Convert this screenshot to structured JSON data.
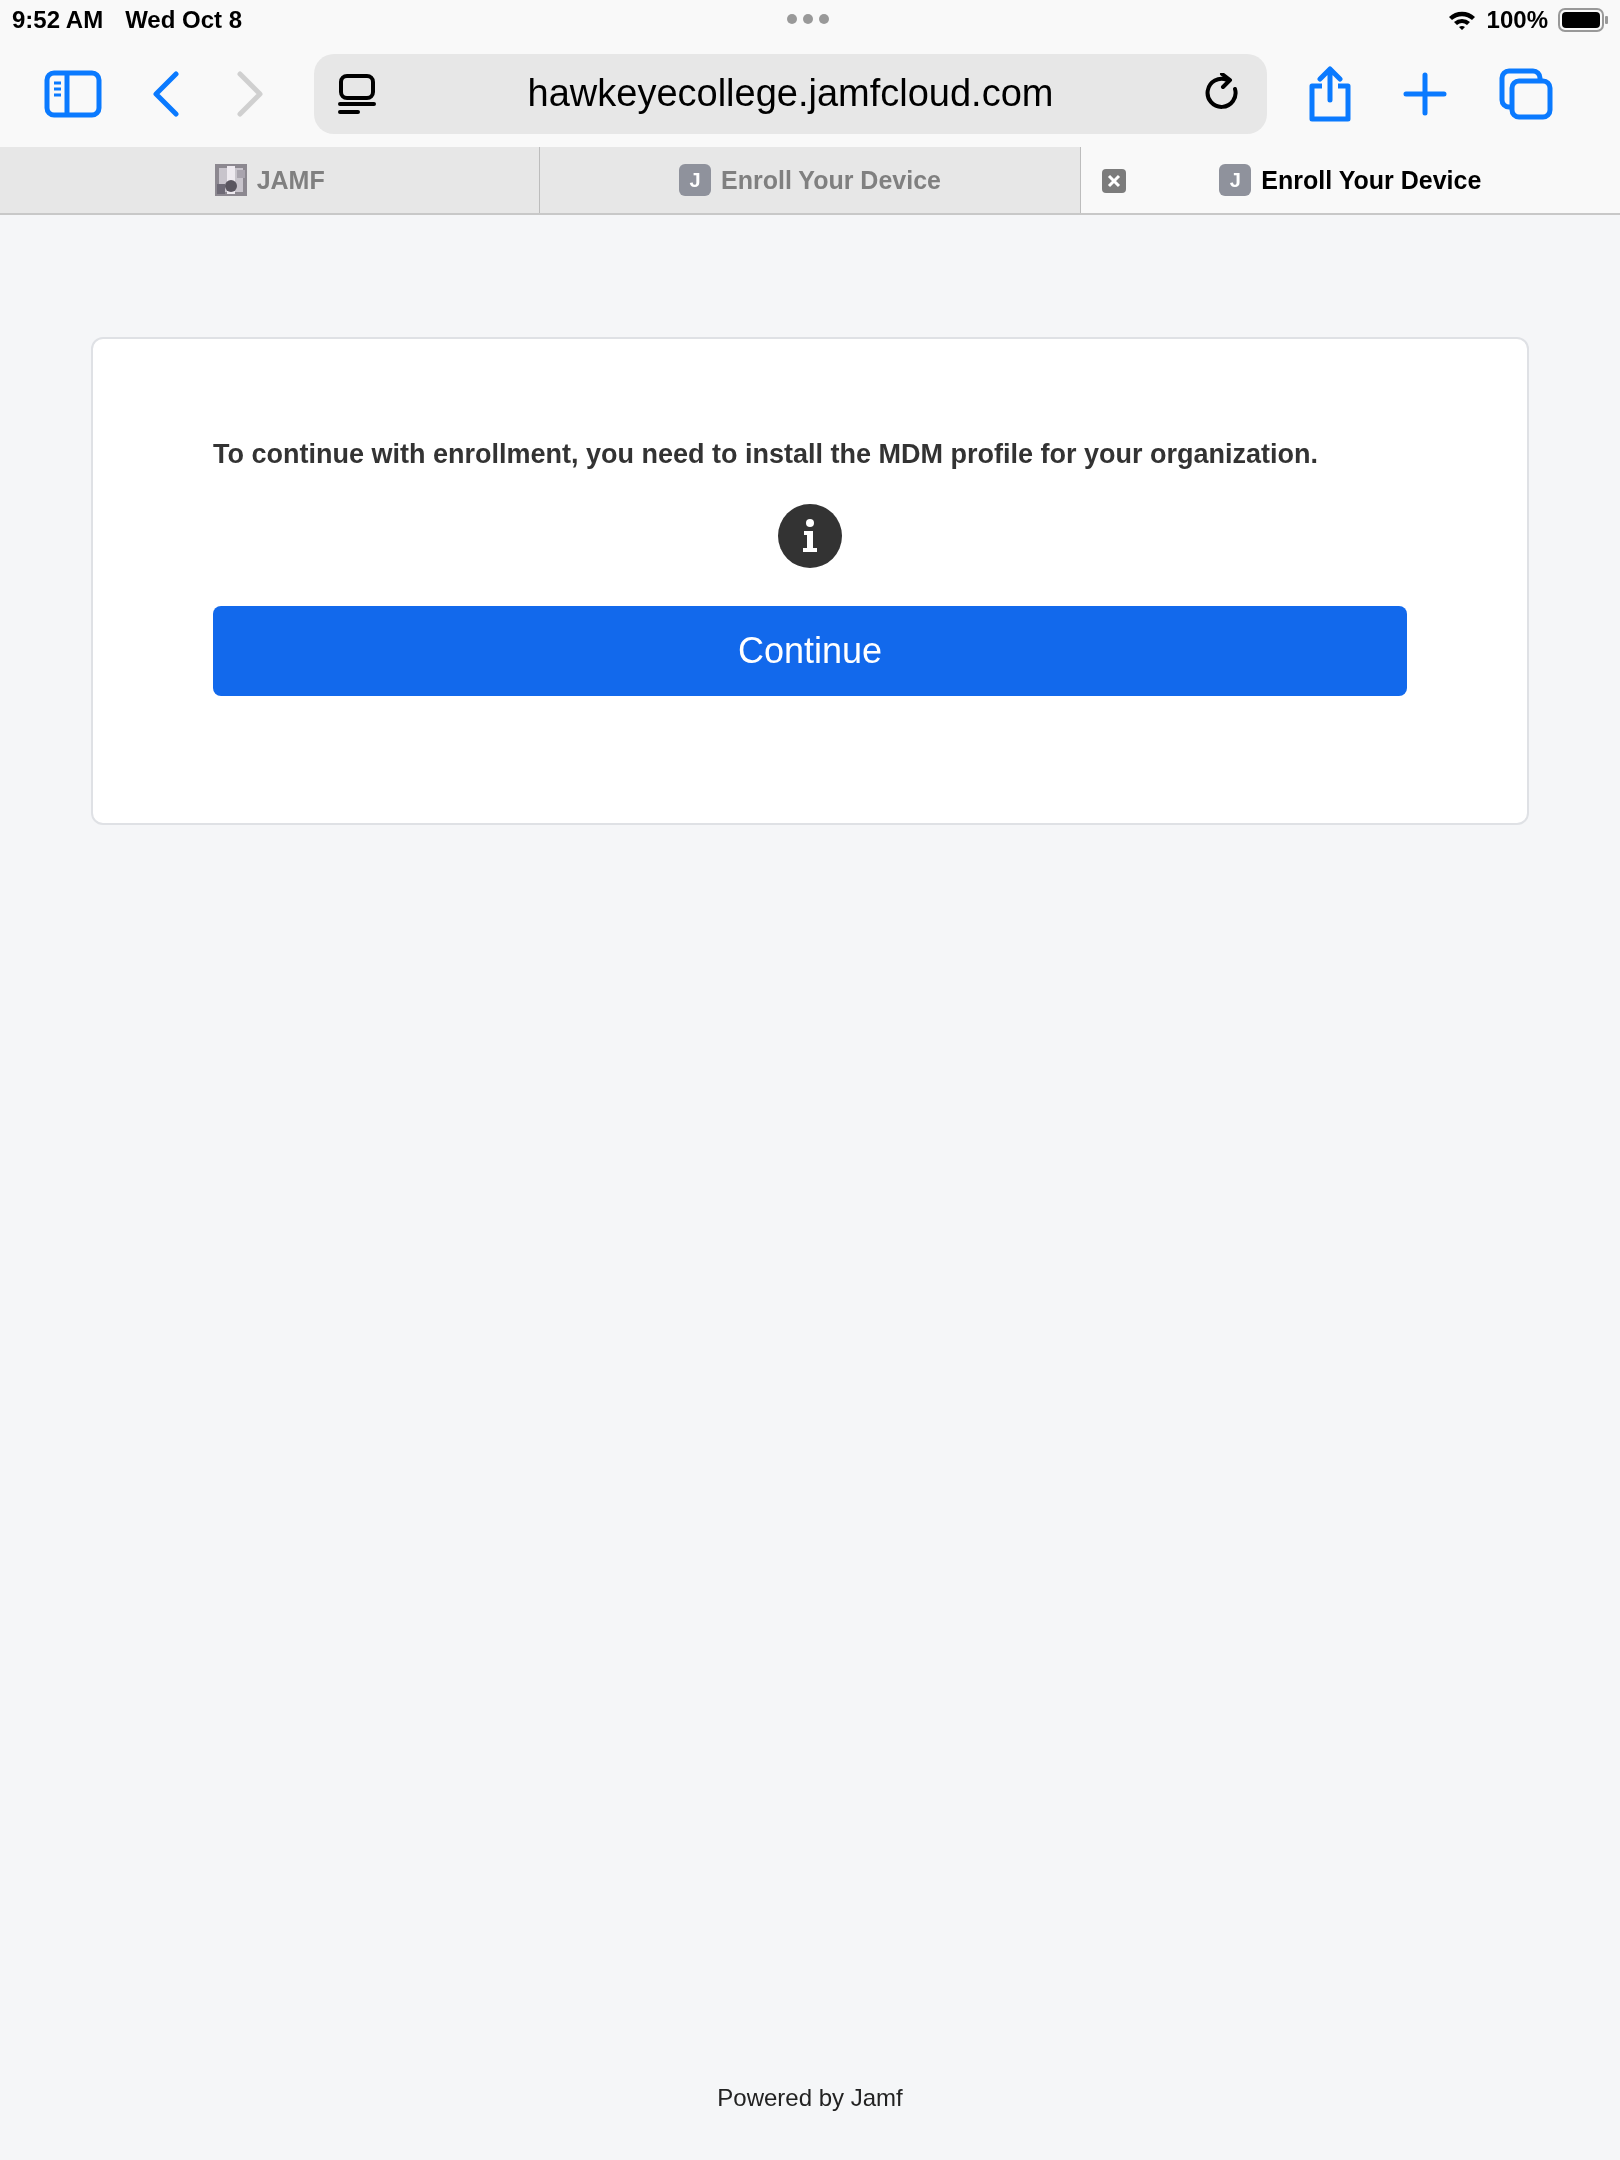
{
  "status_bar": {
    "time": "9:52 AM",
    "date": "Wed Oct 8",
    "battery": "100%"
  },
  "toolbar": {
    "url": "hawkeyecollege.jamfcloud.com"
  },
  "tabs": [
    {
      "title": "JAMF",
      "selected": false
    },
    {
      "title": "Enroll Your Device",
      "favicon": {
        "kind": "letter",
        "letter": "J"
      },
      "selected": false
    },
    {
      "title": "Enroll Your Device",
      "favicon": {
        "kind": "letter",
        "letter": "J"
      },
      "selected": true
    }
  ],
  "card": {
    "message": "To continue with enrollment, you need to install the MDM profile for your organization.",
    "button": "Continue"
  },
  "footer": "Powered by Jamf"
}
